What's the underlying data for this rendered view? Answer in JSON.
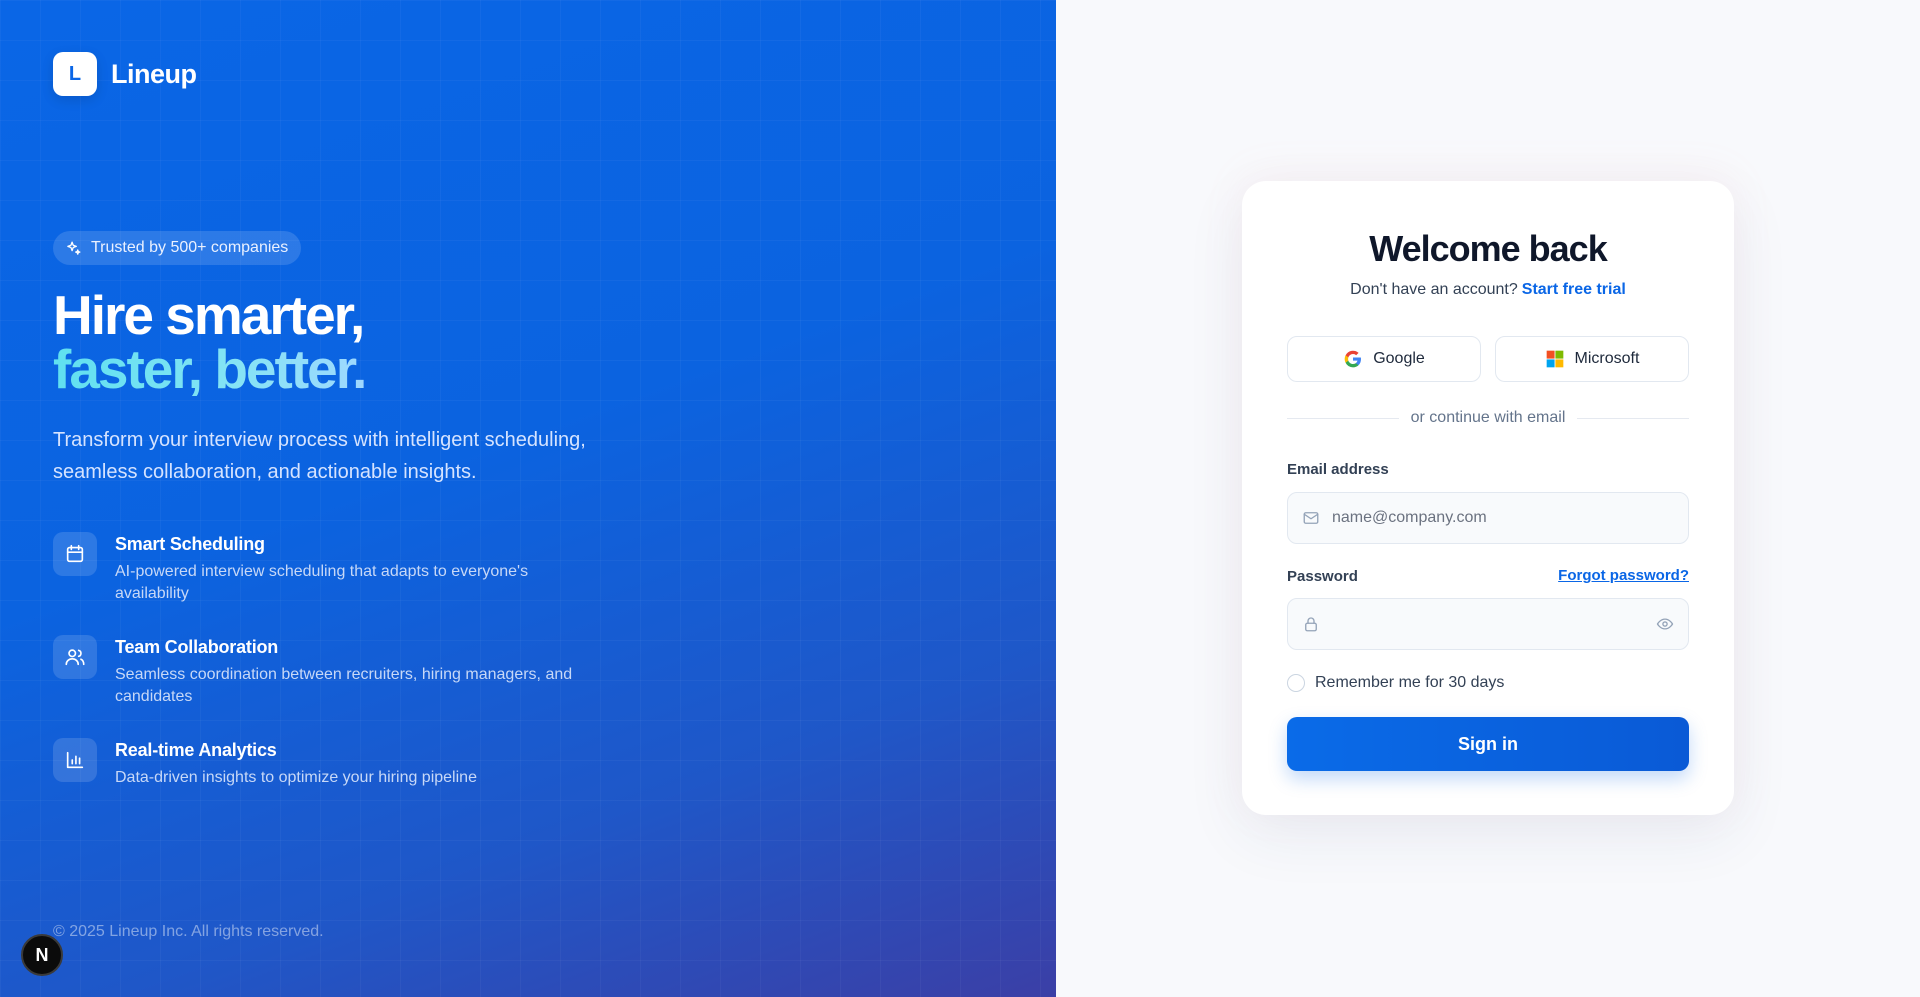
{
  "brand": {
    "logo_letter": "L",
    "name": "Lineup"
  },
  "hero": {
    "badge": "Trusted by 500+ companies",
    "headline_line1": "Hire smarter,",
    "headline_line2": "faster, better.",
    "subtitle": "Transform your interview process with intelligent scheduling, seamless collaboration, and actionable insights.",
    "features": [
      {
        "icon": "calendar-icon",
        "title": "Smart Scheduling",
        "description": "AI-powered interview scheduling that adapts to everyone's availability"
      },
      {
        "icon": "users-icon",
        "title": "Team Collaboration",
        "description": "Seamless coordination between recruiters, hiring managers, and candidates"
      },
      {
        "icon": "bar-chart-icon",
        "title": "Real-time Analytics",
        "description": "Data-driven insights to optimize your hiring pipeline"
      }
    ],
    "copyright": "© 2025 Lineup Inc. All rights reserved."
  },
  "dev_badge": {
    "letter": "N"
  },
  "login": {
    "title": "Welcome back",
    "signup_prompt": "Don't have an account?",
    "signup_link": "Start free trial",
    "sso": {
      "google": "Google",
      "microsoft": "Microsoft"
    },
    "divider": "or continue with email",
    "email_label": "Email address",
    "email_placeholder": "name@company.com",
    "password_label": "Password",
    "forgot": "Forgot password?",
    "remember": "Remember me for 30 days",
    "submit": "Sign in"
  },
  "colors": {
    "brand_blue": "#0a66e6",
    "hero_gradient_end": "#3b3fa6",
    "accent_cyan": "#5fe0f0"
  }
}
